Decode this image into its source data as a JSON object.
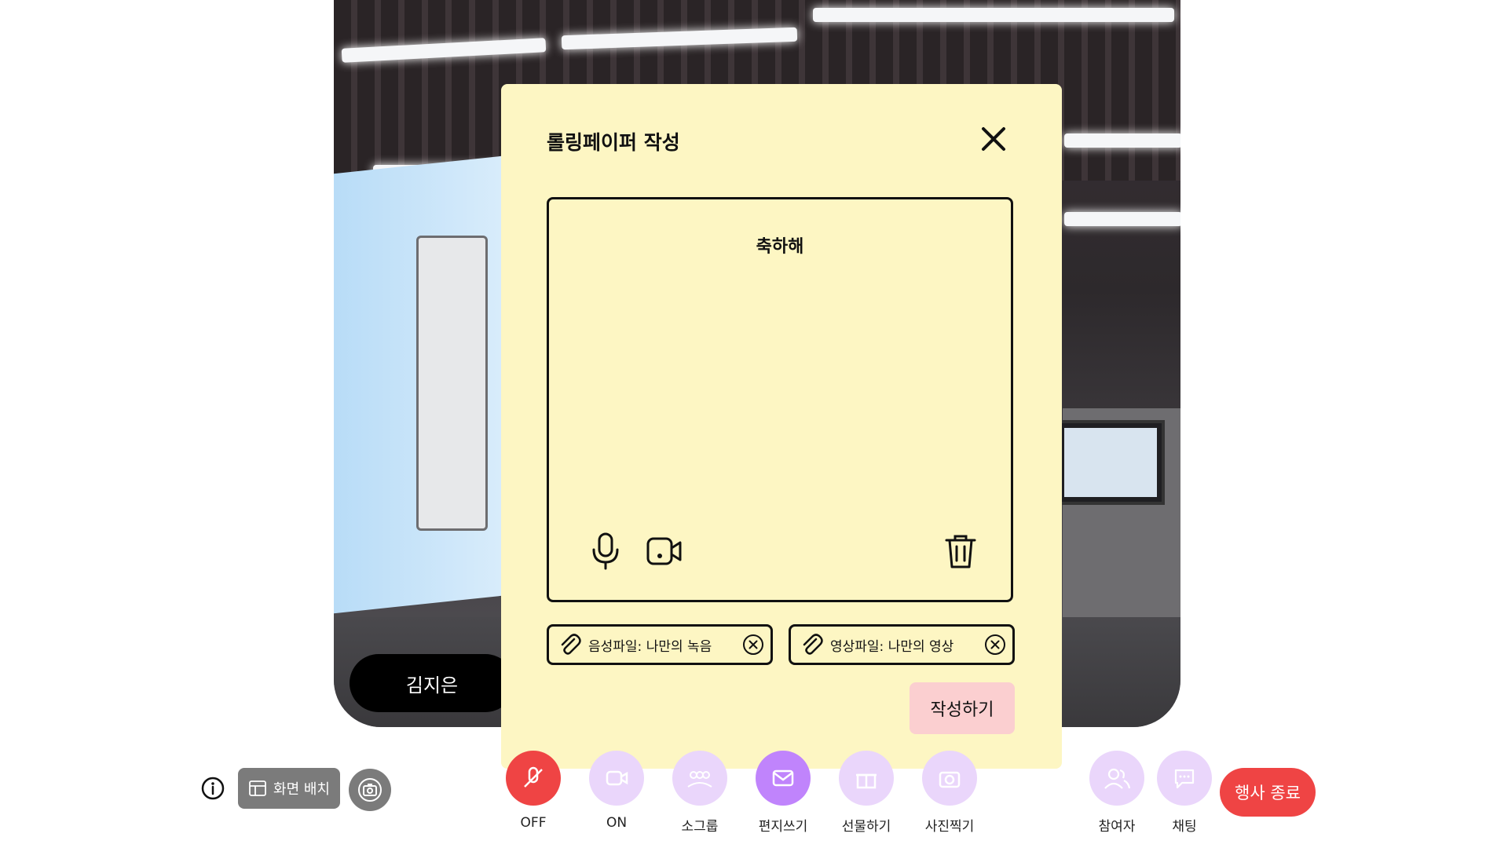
{
  "video": {
    "participant_name": "김지은"
  },
  "modal": {
    "title": "롤링페이퍼 작성",
    "close_icon": "close-icon",
    "message": "축하해",
    "tools": [
      "microphone-icon",
      "video-camera-icon",
      "trash-icon"
    ],
    "attachments": [
      {
        "label": "음성파일: 나만의 녹음"
      },
      {
        "label": "영상파일: 나만의 영상"
      }
    ],
    "submit_label": "작성하기"
  },
  "toolbar": {
    "layout_label": "화면 배치",
    "items": [
      {
        "label": "OFF",
        "icon": "mic-off-icon",
        "color": "#ef4444"
      },
      {
        "label": "ON",
        "icon": "video-on-icon",
        "color": "#ead6fb"
      },
      {
        "label": "소그룹",
        "icon": "group-icon",
        "color": "#ead6fb"
      },
      {
        "label": "편지쓰기",
        "icon": "letter-icon",
        "color": "#c084fc"
      },
      {
        "label": "선물하기",
        "icon": "gift-icon",
        "color": "#ead6fb"
      },
      {
        "label": "사진찍기",
        "icon": "camera-icon",
        "color": "#ead6fb"
      }
    ],
    "right_items": [
      {
        "label": "참여자",
        "icon": "participants-icon",
        "color": "#ead6fb"
      },
      {
        "label": "채팅",
        "icon": "chat-icon",
        "color": "#ead6fb"
      }
    ],
    "end_label": "행사 종료",
    "end_color": "#ef4444"
  }
}
